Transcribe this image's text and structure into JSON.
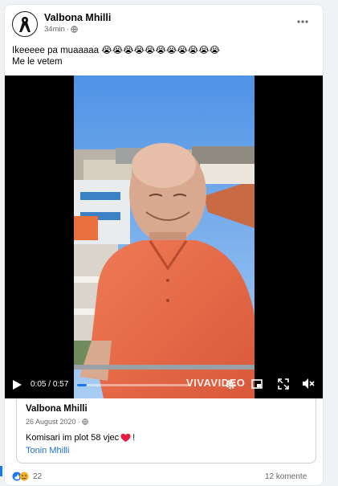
{
  "post": {
    "author": "Valbona Mhilli",
    "time": "34min",
    "caption_line1": "Ikeeeee pa muaaaaa 😭😭😭😭😭😭😭😭😭😭😭",
    "caption_line2": "Me le vetem",
    "privacy_icon": "globe-icon",
    "more_icon": "more-horizontal-icon"
  },
  "video": {
    "time_current": "0:05",
    "time_sep": " / ",
    "time_total": "0:57",
    "progress": 0.088,
    "watermark": "VIVAVIDEO",
    "icons": [
      "play-icon",
      "settings-icon",
      "pip-icon",
      "fullscreen-icon",
      "mute-icon"
    ]
  },
  "shared_post": {
    "author": "Valbona Mhilli",
    "date": "26 August 2020",
    "text": "Komisari im plot 58 vjec",
    "heart_icon": "heart-icon",
    "tag": "Tonin Mhilli"
  },
  "footer": {
    "reaction_count": "22",
    "comments": "12 komente"
  },
  "colors": {
    "accent": "#216fdb",
    "heart": "#e41e3f",
    "progress": "#1877f2"
  }
}
